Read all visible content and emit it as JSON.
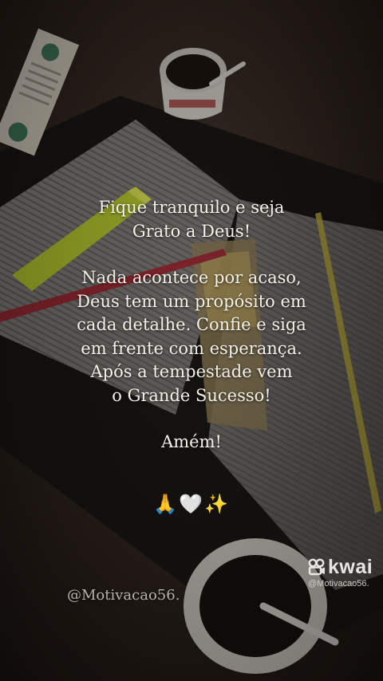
{
  "message": {
    "lines_a": [
      "Fique tranquilo e seja",
      "Grato a Deus!"
    ],
    "lines_b": [
      "Nada acontece por acaso,",
      "Deus tem um propósito em",
      "cada detalhe. Confie e siga",
      "em frente com esperança.",
      "Após a tempestade vem",
      "o Grande Sucesso!"
    ],
    "closing": "Amém!"
  },
  "emoji": "🙏🤍✨",
  "handle": "@Motivacao56.",
  "watermark": {
    "brand": "kwai",
    "user": "@Motivacao56."
  },
  "colors": {
    "text": "#f4f1ea",
    "background": "#2a221d"
  }
}
